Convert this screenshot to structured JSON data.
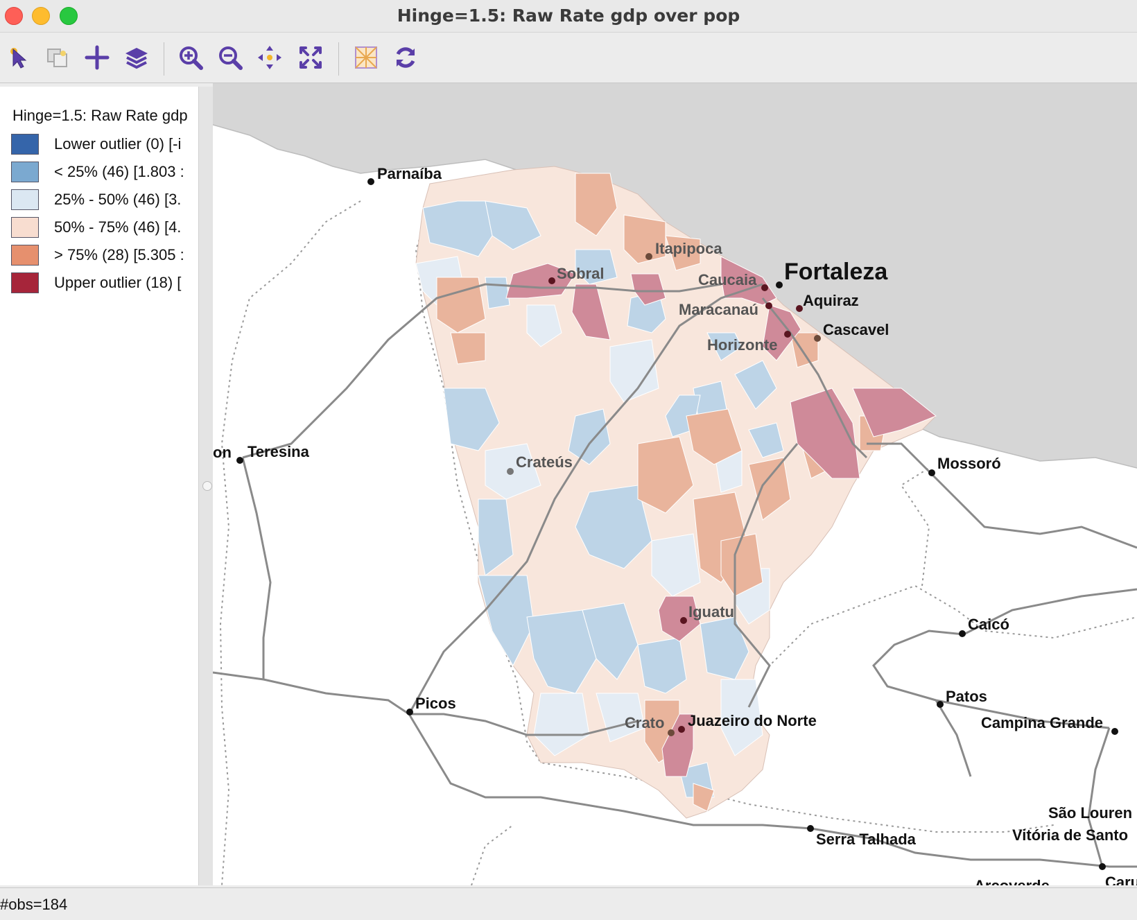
{
  "window": {
    "title": "Hinge=1.5: Raw Rate gdp over pop"
  },
  "toolbar": {
    "buttons": [
      {
        "name": "select-icon"
      },
      {
        "name": "selection-shape-icon"
      },
      {
        "name": "add-icon"
      },
      {
        "name": "layers-icon"
      },
      {
        "name": "zoom-in-icon"
      },
      {
        "name": "zoom-out-icon"
      },
      {
        "name": "pan-icon"
      },
      {
        "name": "full-extent-icon"
      },
      {
        "name": "basemap-icon"
      },
      {
        "name": "refresh-icon"
      }
    ]
  },
  "legend": {
    "title": "Hinge=1.5: Raw Rate gdp",
    "items": [
      {
        "label": "Lower outlier (0)  [-i",
        "color": "#3565aa"
      },
      {
        "label": "< 25% (46)  [1.803 :",
        "color": "#7ba9d0"
      },
      {
        "label": "25% - 50% (46)  [3.",
        "color": "#dbe7f2"
      },
      {
        "label": "50% - 75% (46)  [4.",
        "color": "#f8ddd0"
      },
      {
        "label": "> 75% (28)  [5.305 :",
        "color": "#e6906e"
      },
      {
        "label": "Upper outlier (18)  [",
        "color": "#a6253a"
      }
    ]
  },
  "map": {
    "cities": {
      "parnaiba": "Parnaíba",
      "teresina": "Teresina",
      "teresina_prefix": "on",
      "sobral": "Sobral",
      "itapipoca": "Itapipoca",
      "caucaia": "Caucaia",
      "fortaleza": "Fortaleza",
      "aquiraz": "Aquiraz",
      "maracanau": "Maracanaú",
      "cascavel": "Cascavel",
      "horizonte": "Horizonte",
      "mossoro": "Mossoró",
      "crateus": "Crateús",
      "iguatu": "Iguatu",
      "caico": "Caicó",
      "patos": "Patos",
      "picos": "Picos",
      "crato": "Crato",
      "juazeiro": "Juazeiro do Norte",
      "campina": "Campina Grande",
      "serra": "Serra Talhada",
      "saolouren": "São Louren",
      "vitoria": "Vitória de Santo",
      "arcoverde": "Arcoverde",
      "caru": "Caru"
    }
  },
  "status": {
    "text": "#obs=184"
  }
}
